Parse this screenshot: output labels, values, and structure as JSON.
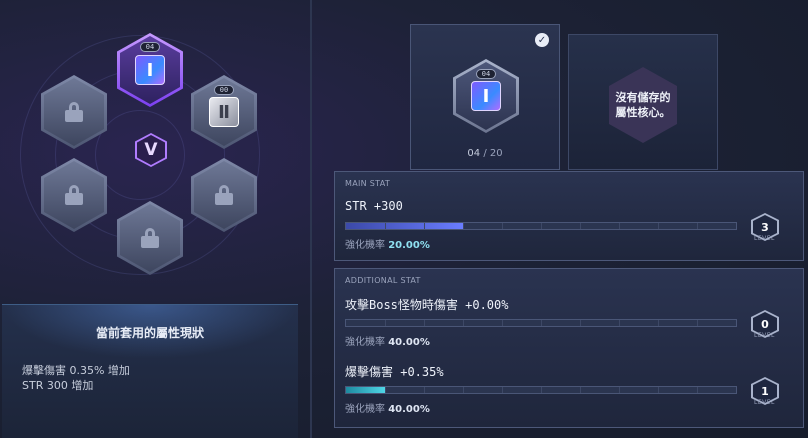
{
  "core_grid": {
    "active_slot_tag": "04",
    "side_slot_tag": "00",
    "active_core_symbol": "Ⅰ",
    "side_core_symbol": "Ⅱ",
    "center_symbol": "V"
  },
  "status": {
    "title": "當前套用的屬性現狀",
    "lines": [
      "爆擊傷害 0.35% 增加",
      "STR 300 增加"
    ]
  },
  "card": {
    "tag": "04",
    "core_symbol": "Ⅰ",
    "count_current": "04",
    "count_sep": "/",
    "count_total": "20"
  },
  "empty_card": {
    "text_line1": "沒有儲存的",
    "text_line2": "屬性核心。"
  },
  "main_stat": {
    "header": "MAIN STAT",
    "name": "STR +300",
    "rate_label": "強化機率",
    "rate_value": "20.00%",
    "level": "3",
    "level_label": "LEVEL",
    "fill_fraction": 0.3
  },
  "additional_stat": {
    "header": "ADDITIONAL STAT",
    "stat1": {
      "name": "攻擊Boss怪物時傷害 +0.00%",
      "rate_label": "強化機率",
      "rate_value": "40.00%",
      "level": "0",
      "level_label": "LEVEL",
      "fill_fraction": 0
    },
    "stat2": {
      "name": "爆擊傷害 +0.35%",
      "rate_label": "強化機率",
      "rate_value": "40.00%",
      "level": "1",
      "level_label": "LEVEL",
      "fill_fraction": 0.1
    }
  },
  "colors": {
    "accent_purple": "#b07cff",
    "bar_blue": "#6a7dff",
    "bar_cyan": "#4fd6e6"
  }
}
